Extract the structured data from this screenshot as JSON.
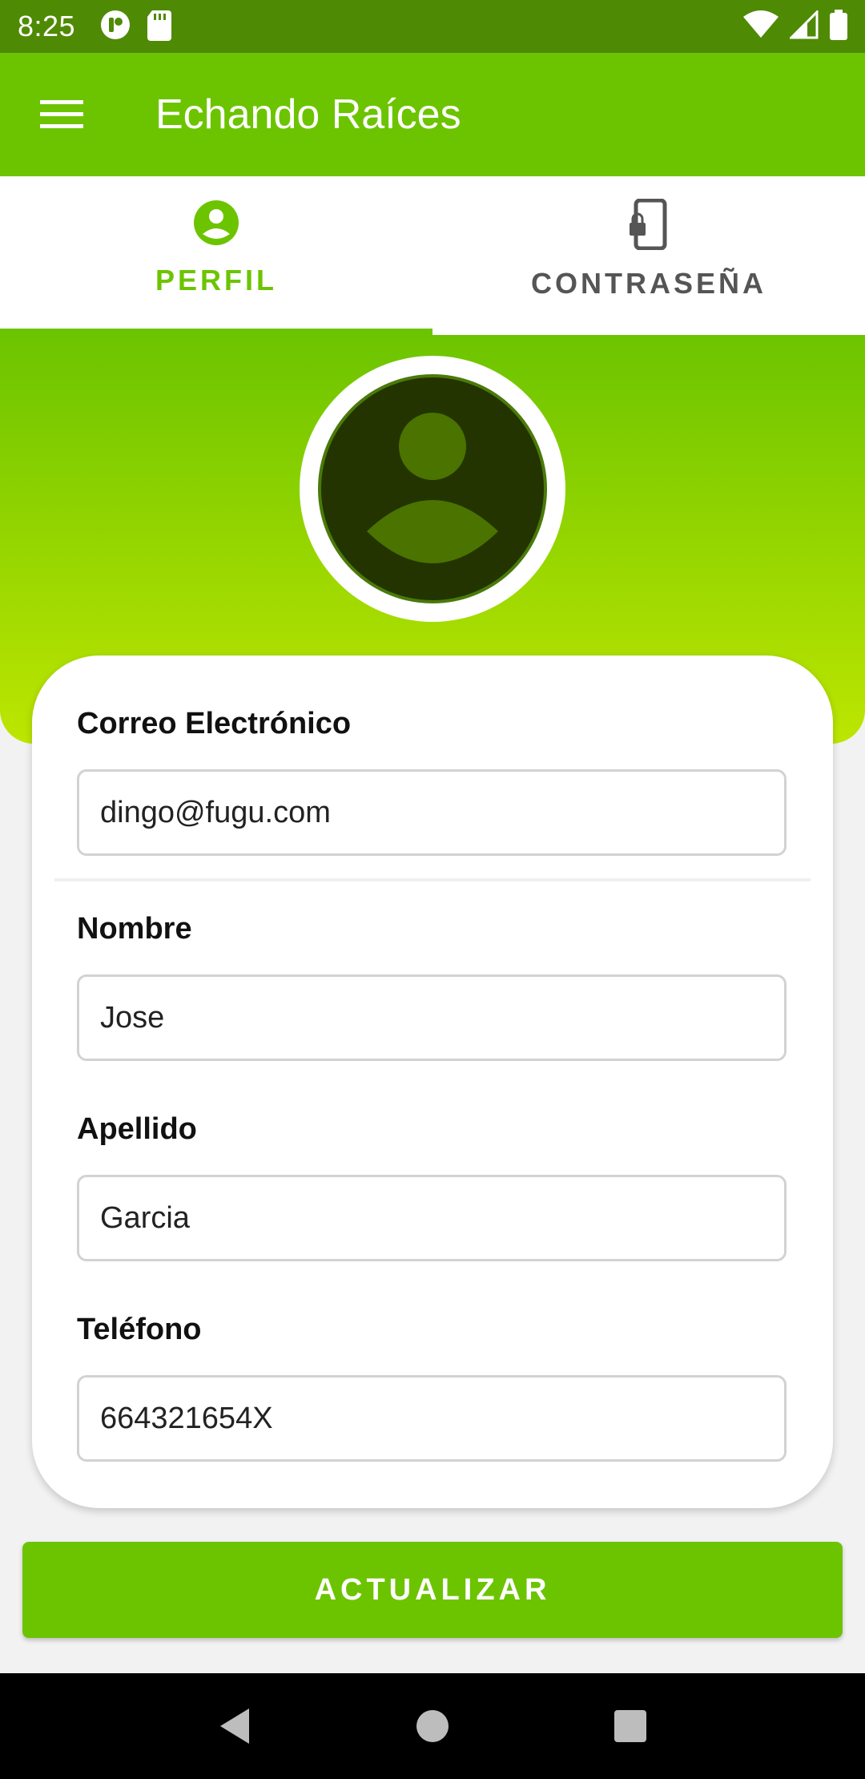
{
  "status_bar": {
    "time": "8:25",
    "left_icons": [
      "notification-icon",
      "sd-card-icon"
    ],
    "right_icons": [
      "wifi-icon",
      "signal-icon",
      "battery-icon"
    ]
  },
  "app_bar": {
    "title": "Echando Raíces",
    "menu_icon": "hamburger-menu-icon",
    "color": "#6cc400"
  },
  "tabs": [
    {
      "label": "PERFIL",
      "icon": "account-circle-icon",
      "active": true
    },
    {
      "label": "CONTRASEÑA",
      "icon": "phone-lock-icon",
      "active": false
    }
  ],
  "profile": {
    "avatar": "default-user-avatar"
  },
  "form": {
    "email": {
      "label": "Correo Electrónico",
      "value": "dingo@fugu.com"
    },
    "first_name": {
      "label": "Nombre",
      "value": "Jose"
    },
    "last_name": {
      "label": "Apellido",
      "value": "Garcia"
    },
    "phone": {
      "label": "Teléfono",
      "value": "664321654X"
    }
  },
  "actions": {
    "update_label": "ACTUALIZAR"
  },
  "nav_bar": {
    "icons": [
      "back-icon",
      "home-icon",
      "recents-icon"
    ]
  },
  "colors": {
    "primary": "#6cc400",
    "status_bar": "#4f8a04",
    "gradient_end": "#bde600",
    "avatar_bg": "#233400"
  }
}
